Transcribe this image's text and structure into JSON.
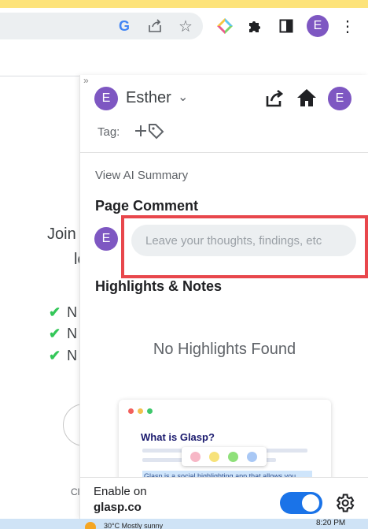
{
  "browser": {
    "avatar_letter": "E",
    "toolbar_icons": [
      "google-icon",
      "share-icon",
      "star-icon",
      "extension-diamond-icon",
      "puzzle-icon",
      "side-panel-icon",
      "menu-kebab-icon"
    ]
  },
  "background_page": {
    "heading_line1": "Join",
    "heading_line2": "lo",
    "checklist": [
      "N",
      "N",
      "N"
    ],
    "footer_text": "Cl"
  },
  "panel": {
    "collapse_glyph": "»",
    "user": {
      "avatar_letter": "E",
      "name": "Esther"
    },
    "header_avatar_letter": "E",
    "tag_label": "Tag:",
    "view_ai_summary": "View AI Summary",
    "page_comment_title": "Page Comment",
    "comment_avatar_letter": "E",
    "comment_placeholder": "Leave your thoughts, findings, etc",
    "highlights_title": "Highlights & Notes",
    "no_highlights": "No Highlights Found",
    "promo_card": {
      "title": "What is Glasp?",
      "highlight_text": "Glasp is a social highlighting app that allows you",
      "window_dots": [
        "#f25f5c",
        "#f2c14e",
        "#3ec76b"
      ],
      "palette_colors": [
        "#f7b7c6",
        "#f7e27a",
        "#8fe07a",
        "#a9c8f5"
      ]
    },
    "footer": {
      "enable_line1": "Enable on",
      "enable_line2": "glasp.co",
      "toggle_on": true
    }
  },
  "taskbar": {
    "weather_text": "30°C  Mostly sunny",
    "time": "8:20 PM"
  },
  "colors": {
    "accent_purple": "#7e57c2",
    "toggle_blue": "#1a73e8",
    "annotation_red": "#e8474c"
  }
}
